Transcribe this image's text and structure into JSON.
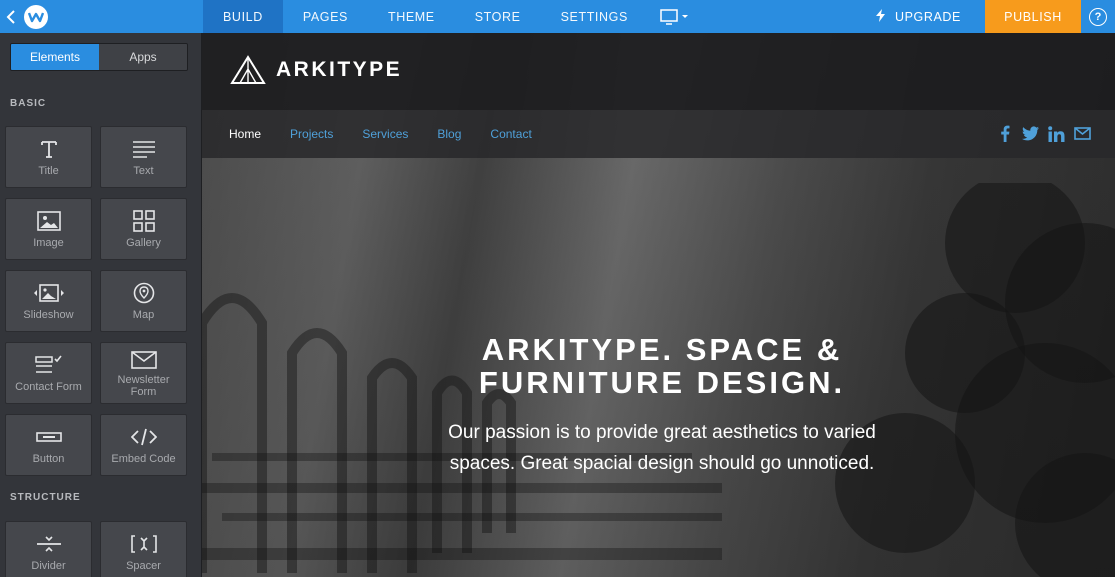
{
  "topbar": {
    "nav": [
      "BUILD",
      "PAGES",
      "THEME",
      "STORE",
      "SETTINGS"
    ],
    "active": "BUILD",
    "upgrade_label": "UPGRADE",
    "publish_label": "PUBLISH",
    "help_label": "?",
    "colors": {
      "bar": "#2a8de0",
      "active": "#1f72c4",
      "publish": "#f79b1c"
    }
  },
  "sidebar": {
    "tabs": [
      "Elements",
      "Apps"
    ],
    "active_tab": "Elements",
    "basic_title": "BASIC",
    "structure_title": "STRUCTURE",
    "basic_items": [
      {
        "label": "Title",
        "icon": "title-icon"
      },
      {
        "label": "Text",
        "icon": "text-icon"
      },
      {
        "label": "Image",
        "icon": "image-icon"
      },
      {
        "label": "Gallery",
        "icon": "gallery-icon"
      },
      {
        "label": "Slideshow",
        "icon": "slideshow-icon"
      },
      {
        "label": "Map",
        "icon": "map-pin-icon"
      },
      {
        "label": "Contact Form",
        "icon": "contact-form-icon"
      },
      {
        "label": "Newsletter Form",
        "icon": "envelope-icon"
      },
      {
        "label": "Button",
        "icon": "button-icon"
      },
      {
        "label": "Embed Code",
        "icon": "code-icon"
      }
    ],
    "structure_items": [
      {
        "label": "Divider",
        "icon": "divider-icon"
      },
      {
        "label": "Spacer",
        "icon": "spacer-icon"
      }
    ]
  },
  "site": {
    "brand": "ARKITYPE",
    "nav": [
      "Home",
      "Projects",
      "Services",
      "Blog",
      "Contact"
    ],
    "current": "Home",
    "social": [
      "facebook-icon",
      "twitter-icon",
      "linkedin-icon",
      "mail-icon"
    ],
    "hero_title_line1": "ARKITYPE. SPACE &",
    "hero_title_line2": "FURNITURE DESIGN.",
    "hero_sub": "Our passion is to provide great aesthetics to varied spaces. Great spacial design should go unnoticed.",
    "colors": {
      "nav_link": "#4fa0d9"
    }
  }
}
